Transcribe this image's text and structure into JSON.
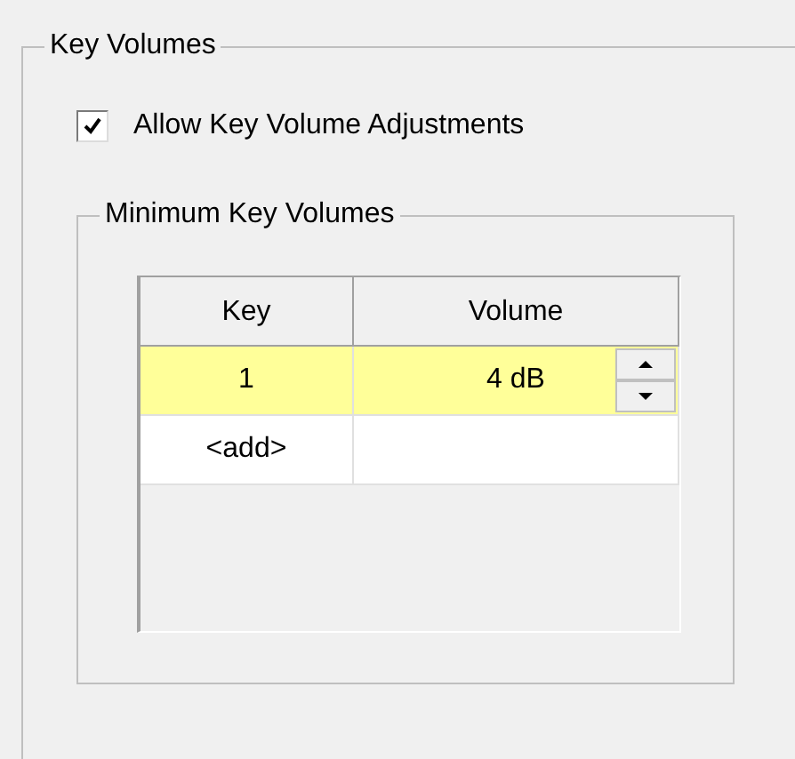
{
  "group": {
    "title": "Key Volumes"
  },
  "allow_adjustments": {
    "label": "Allow Key Volume Adjustments",
    "checked": true
  },
  "minimum_group": {
    "title": "Minimum Key Volumes"
  },
  "table": {
    "columns": [
      "Key",
      "Volume"
    ],
    "rows": [
      {
        "key": "1",
        "volume": "4 dB",
        "selected": true
      },
      {
        "key": "<add>",
        "selected": false
      }
    ]
  }
}
